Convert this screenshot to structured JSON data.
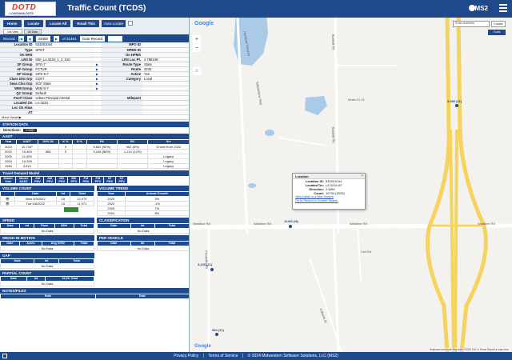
{
  "app": {
    "logo_text": "DOTD",
    "logo_subtext": "LOUISIANA DOTD",
    "title": "Traffic Count (TCDS)",
    "brand": "MS2"
  },
  "toolbar": {
    "buttons": [
      "Home",
      "Locate",
      "Locate All",
      "Email This"
    ],
    "auto_locate_label": "Auto-Locate"
  },
  "tabs": [
    "List View",
    "All Data"
  ],
  "record": {
    "label": "Record",
    "current": "43492",
    "total_label": "of 31461",
    "goto_label": "Goto Record"
  },
  "location_info": [
    {
      "label": "Location ID",
      "value": "531001044",
      "label2": "MPO ID",
      "value2": ""
    },
    {
      "label": "Type",
      "value": "SPOT",
      "label2": "HPMS ID",
      "value2": ""
    },
    {
      "label": "On NHS",
      "value": "",
      "label2": "On HPMS",
      "value2": ""
    },
    {
      "label": "LRS ID",
      "value": "000_LA 3234_1_2_010",
      "label2": "LRS Loc Pt.",
      "value2": "2.788108"
    },
    {
      "label": "SF Group",
      "value": "SFG-7",
      "arrow": true,
      "label2": "Route Type",
      "value2": "State"
    },
    {
      "label": "AF Group",
      "value": "FCTUR",
      "arrow": true,
      "label2": "Route",
      "value2": "3234"
    },
    {
      "label": "GF Group",
      "value": "GFG 5-7",
      "arrow": true,
      "label2": "Active",
      "value2": "Yes"
    },
    {
      "label": "Class Dist Grp",
      "value": "CDF7",
      "arrow": true,
      "label2": "Category",
      "value2": "Local"
    },
    {
      "label": "Seas Clss Grp",
      "value": "SCF State",
      "arrow": true,
      "label2": "",
      "value2": ""
    },
    {
      "label": "WIM Group",
      "value": "WIM S-7",
      "arrow": true,
      "label2": "",
      "value2": ""
    },
    {
      "label": "QC Group",
      "value": "Default",
      "label2": "",
      "value2": ""
    },
    {
      "label": "Fnct'l Class",
      "value": "Urban Principal Arterial",
      "label2": "Milepost",
      "value2": ""
    },
    {
      "label": "Located On",
      "value": "LA 3234",
      "label2": "",
      "value2": ""
    },
    {
      "label": "Loc On Alias",
      "value": "",
      "label2": "",
      "value2": ""
    },
    {
      "label": "AT",
      "value": "",
      "label2": "",
      "value2": ""
    }
  ],
  "more_detail": "More Detail ▶",
  "station_data": {
    "title": "STATION DATA",
    "directions_label": "Directions:",
    "directions_value": "2-WAY"
  },
  "aadt": {
    "title": "AADT",
    "columns": [
      "Year",
      "AADT",
      "DHV-30",
      "K %",
      "D %",
      "PA",
      "BC",
      "Src"
    ],
    "rows": [
      [
        "2023",
        "10,734³",
        "",
        "9",
        "",
        "9,832 (92%)",
        "902 (8%)",
        "Grown from 2022"
      ],
      [
        "2022",
        "10,460",
        "968",
        "9",
        "",
        "9,246 (88%)",
        "1,214 (12%)",
        ""
      ],
      [
        "2005",
        "11,509",
        "",
        "",
        "",
        "",
        "",
        "Legacy"
      ],
      [
        "2004",
        "10,265",
        "",
        "",
        "",
        "",
        "",
        "Legacy"
      ],
      [
        "1984",
        "3,015",
        "",
        "",
        "",
        "",
        "",
        "Legacy"
      ]
    ]
  },
  "travel_demand": {
    "title": "Travel Demand Model",
    "columns": [
      "Model Year",
      "Model AADT",
      "AM PHV",
      "AM PPV",
      "MD PHV",
      "MD PPV",
      "PM PHV",
      "PM PPV",
      "NT PHV",
      "NT PPV"
    ]
  },
  "volume_count": {
    "title": "VOLUME COUNT",
    "columns": [
      "",
      "Date",
      "Int",
      "Total"
    ],
    "rows": [
      [
        "Wed 3/9/2022",
        "15",
        "12,074"
      ],
      [
        "Tue 3/8/2022",
        "15",
        "11,971"
      ]
    ]
  },
  "volume_trend": {
    "title": "VOLUME TREND",
    "columns": [
      "Year",
      "Annual Growth"
    ],
    "rows": [
      [
        "2023",
        "3%"
      ],
      [
        "2022",
        "-1%"
      ],
      [
        "2005",
        "7%"
      ],
      [
        "2004",
        "8%"
      ]
    ]
  },
  "speed": {
    "title": "SPEED",
    "columns": [
      "Date",
      "Int",
      "Pace",
      "85th",
      "Total"
    ],
    "empty": "No Data"
  },
  "classification": {
    "title": "CLASSIFICATION",
    "columns": [
      "Date",
      "Int",
      "Total"
    ],
    "empty": "No Data"
  },
  "wim": {
    "title": "WEIGH-IN-MOTION",
    "columns": [
      "Date",
      "Axles",
      "Avg GVW",
      "Total"
    ],
    "empty": "No Data"
  },
  "per_vehicle": {
    "title": "PER VEHICLE",
    "columns": [
      "Date",
      "Int",
      "Total"
    ],
    "empty": "No Data"
  },
  "gap": {
    "title": "GAP",
    "columns": [
      "Date",
      "Int",
      "Total"
    ],
    "empty": "No Data"
  },
  "partial_count": {
    "title": "PARTIAL COUNT",
    "columns": [
      "Date",
      "Int",
      "24-Hr Total"
    ],
    "empty": "No Data"
  },
  "notes": {
    "title": "NOTES/FILES",
    "columns": [
      "Note",
      "Date"
    ]
  },
  "map": {
    "google_label": "Google",
    "address_placeholder": "Enter Address",
    "address_button": "Locate",
    "filter_button": "Tools",
    "roads": {
      "wardline1": "Wardline Rd",
      "wardline2": "Wardline Rd",
      "wardline3": "Wardline Rd",
      "wardline4": "Wardline Rd",
      "randall1": "Randall Rd",
      "randall2": "Randall Rd",
      "yellowstone1": "Yellowstone Hwy",
      "yellowstone2": "Hemlock Pond Dr",
      "pocatello": "Pocatello Rd",
      "nbuild": "Cell Rd",
      "sid": "Cabana St",
      "motel": "Motel 21 Ct"
    },
    "counts": {
      "c1": "3,289 (21)",
      "c2": "19,000 (26)",
      "c3": "3,245 (21)",
      "c4": "544 (21)"
    },
    "popup": {
      "title": "Location",
      "location_id_label": "Location ID:",
      "location_id": "531001044",
      "located_on_label": "Located On:",
      "located_on": "LA 3234 AT",
      "direction_label": "Direction:",
      "direction": "2-WAY",
      "count_label": "Count:",
      "count": "10734 (2023)",
      "link1": "View Detail in a New Search",
      "link2": "Go to Record in Current Search"
    },
    "attribution": "Keyboard shortcuts   Map data ©2024   100 m   Terms   Report a map error"
  },
  "footer": {
    "privacy": "Privacy Policy",
    "sep": "|",
    "terms": "Terms of Service",
    "copyright": "© 2024 Midwestern Software Solutions, LLC (MS2)"
  },
  "colors": {
    "primary": "#1e4a8c",
    "highway": "#f4d35e",
    "water": "#a9cbe8"
  }
}
